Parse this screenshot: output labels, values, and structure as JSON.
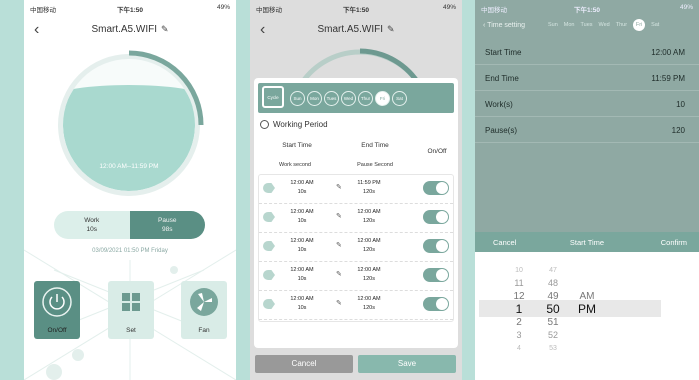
{
  "status": {
    "carrier": "中国移动",
    "time": "下午1:50",
    "battery": "49%"
  },
  "screen1": {
    "title": "Smart.A5.WIFI",
    "time_range": "12:00 AM--11:59 PM",
    "work": {
      "label": "Work",
      "value": "10s"
    },
    "pause": {
      "label": "Pause",
      "value": "98s"
    },
    "datetime": "03/09/2021 01:50 PM Friday",
    "buttons": [
      {
        "label": "On/Off",
        "icon": "power-icon"
      },
      {
        "label": "Set",
        "icon": "grid-icon"
      },
      {
        "label": "Fan",
        "icon": "fan-icon"
      }
    ]
  },
  "screen2": {
    "title": "Smart.A5.WIFI",
    "cycle_label": "Cycle",
    "days": [
      "Sun",
      "Mon",
      "Tues",
      "Wed",
      "Thur",
      "Fri",
      "Sat"
    ],
    "selected_day": "Fri",
    "working_period": "Working Period",
    "headers": {
      "start": "Start Time",
      "end": "End Time",
      "onoff": "On/Off",
      "work_second": "Work second",
      "pause_second": "Pause Second"
    },
    "rows": [
      {
        "tag": "On",
        "start": "12:00 AM",
        "start_sec": "10s",
        "end": "11:59 PM",
        "end_sec": "120s",
        "on": true
      },
      {
        "tag": "On",
        "start": "12:00 AM",
        "start_sec": "10s",
        "end": "12:00 AM",
        "end_sec": "120s",
        "on": true
      },
      {
        "tag": "On",
        "start": "12:00 AM",
        "start_sec": "10s",
        "end": "12:00 AM",
        "end_sec": "120s",
        "on": true
      },
      {
        "tag": "On",
        "start": "12:00 AM",
        "start_sec": "10s",
        "end": "12:00 AM",
        "end_sec": "120s",
        "on": true
      },
      {
        "tag": "On",
        "start": "12:00 AM",
        "start_sec": "10s",
        "end": "12:00 AM",
        "end_sec": "120s",
        "on": true
      }
    ],
    "cancel": "Cancel",
    "save": "Save"
  },
  "screen3": {
    "title": "Time setting",
    "days": [
      "Sun",
      "Mon",
      "Tues",
      "Wed",
      "Thur",
      "Fri",
      "Sat"
    ],
    "selected_day": "Fri",
    "fields": [
      {
        "key": "Start Time",
        "value": "12:00 AM"
      },
      {
        "key": "End Time",
        "value": "11:59 PM"
      },
      {
        "key": "Work(s)",
        "value": "10"
      },
      {
        "key": "Pause(s)",
        "value": "120"
      }
    ],
    "picker": {
      "cancel": "Cancel",
      "title": "Start Time",
      "confirm": "Confirm",
      "hours": [
        "10",
        "11",
        "12",
        "1",
        "2",
        "3",
        "4"
      ],
      "minutes": [
        "47",
        "48",
        "49",
        "50",
        "51",
        "52",
        "53"
      ],
      "ampm": [
        "AM",
        "PM"
      ]
    }
  }
}
